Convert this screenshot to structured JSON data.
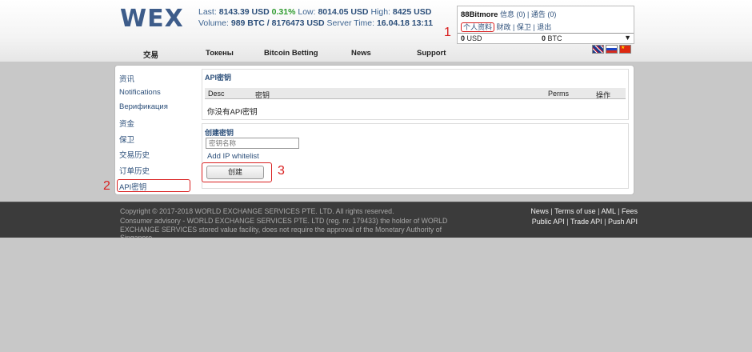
{
  "header": {
    "logo": "WEX",
    "ticker": {
      "last_label": "Last:",
      "last_value": "8143.39 USD",
      "change": "0.31%",
      "low_label": "Low:",
      "low_value": "8014.05 USD",
      "high_label": "High:",
      "high_value": "8425 USD",
      "volume_label": "Volume:",
      "volume_value": "989 BTC / 8176473 USD",
      "server_label": "Server Time:",
      "server_value": "16.04.18 13:11"
    },
    "nav": [
      "交易",
      "Токены",
      "Bitcoin Betting",
      "News",
      "Support"
    ],
    "user": {
      "name": "88Bitmore",
      "messages": "信息 (0)",
      "notices": "通告 (0)",
      "profile": "个人资料",
      "finance": "财政",
      "security": "保卫",
      "logout": "退出",
      "usd_amount": "0",
      "usd_label": "USD",
      "btc_amount": "0",
      "btc_label": "BTC"
    },
    "flags": [
      "uk-flag",
      "russia-flag",
      "china-flag"
    ]
  },
  "sidebar": {
    "items": [
      "资讯",
      "Notifications",
      "Верификация",
      "资金",
      "保卫",
      "交易历史",
      "订单历史",
      "API密钥"
    ],
    "active": "API密钥"
  },
  "api": {
    "title": "API密钥",
    "columns": [
      "Desc",
      "密钥",
      "Perms",
      "操作"
    ],
    "empty_message": "你没有API密钥"
  },
  "create": {
    "title": "创建密钥",
    "name_placeholder": "密钥名称",
    "ip_link": "Add IP whitelist",
    "button": "创建"
  },
  "markers": [
    "1",
    "2",
    "3"
  ],
  "highlight_color": "#d92020",
  "footer": {
    "copyright": "Copyright © 2017-2018 WORLD EXCHANGE SERVICES PTE. LTD. All rights reserved.",
    "advisory": "Consumer advisory - WORLD EXCHANGE SERVICES PTE. LTD (reg. nr. 179433) the holder of WORLD EXCHANGE SERVICES stored value facility, does not require the approval of the Monetary Authority of Singapore.",
    "links_row1": [
      "News",
      "Terms of use",
      "AML",
      "Fees"
    ],
    "links_row2": [
      "Public API",
      "Trade API",
      "Push API"
    ]
  }
}
